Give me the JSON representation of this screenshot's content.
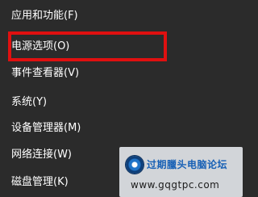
{
  "menu": {
    "items": [
      {
        "label": "应用和功能(F)"
      },
      {
        "label": "电源选项(O)"
      },
      {
        "label": "事件查看器(V)"
      },
      {
        "label": "系统(Y)"
      },
      {
        "label": "设备管理器(M)"
      },
      {
        "label": "网络连接(W)"
      },
      {
        "label": "磁盘管理(K)"
      }
    ]
  },
  "colors": {
    "menu_background": "#2b2b2b",
    "menu_text": "#ffffff",
    "highlight_border": "#e01010",
    "watermark_text": "#1760b5"
  },
  "watermark": {
    "title": "过期臘头电脑论坛",
    "url": "www.gqgtpc.com",
    "icon": "forum-logo-icon"
  }
}
